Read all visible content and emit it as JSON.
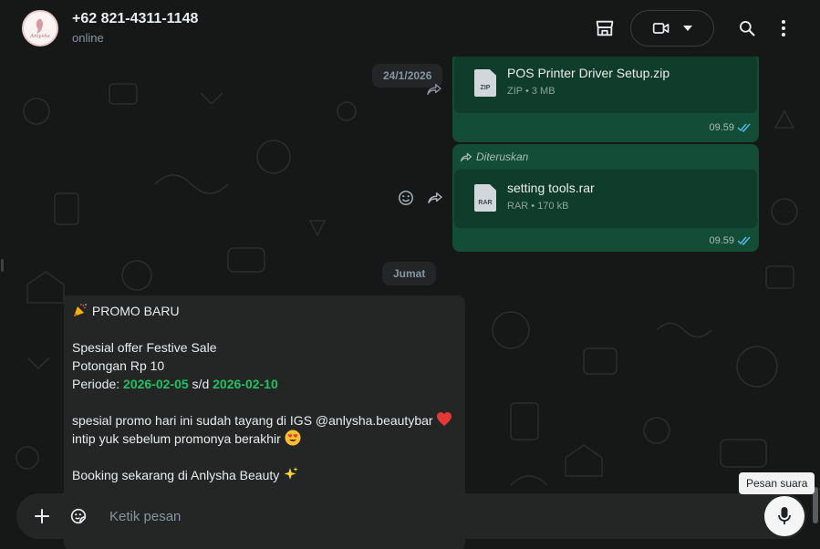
{
  "header": {
    "contact_name": "+62 821-4311-1148",
    "status": "online",
    "avatar_text": "Anlysha",
    "icons": [
      "store-icon",
      "video-call-icon",
      "chevron-down-icon",
      "search-icon",
      "menu-icon"
    ]
  },
  "chat": {
    "date_top": "24/1/2026",
    "messages_out": [
      {
        "file_name": "POS Printer Driver Setup.zip",
        "file_ext": "ZIP",
        "file_meta": "ZIP • 3 MB",
        "time": "09.59"
      },
      {
        "forwarded_label": "Diteruskan",
        "file_name": "setting tools.rar",
        "file_ext": "RAR",
        "file_meta": "RAR • 170 kB",
        "time": "09.59"
      }
    ],
    "date_divider": "Jumat",
    "message_in": {
      "line1": "PROMO BARU",
      "line2": "Spesial offer Festive Sale",
      "line3": "Potongan Rp 10",
      "period_prefix": "Periode: ",
      "period_start": "2026-02-05",
      "period_mid": " s/d ",
      "period_end": "2026-02-10",
      "line5": "spesial promo hari ini sudah tayang di IGS @anlysha.beautybar ",
      "line6": "intip yuk sebelum promonya berakhir ",
      "line7": "Booking sekarang di Anlysha Beauty "
    }
  },
  "composer": {
    "placeholder": "Ketik pesan",
    "mic_tooltip": "Pesan suara"
  },
  "colors": {
    "outgoing_bubble": "#144d37",
    "incoming_bubble": "#242626",
    "accent_green": "#21c063",
    "read_tick": "#53bdeb"
  }
}
